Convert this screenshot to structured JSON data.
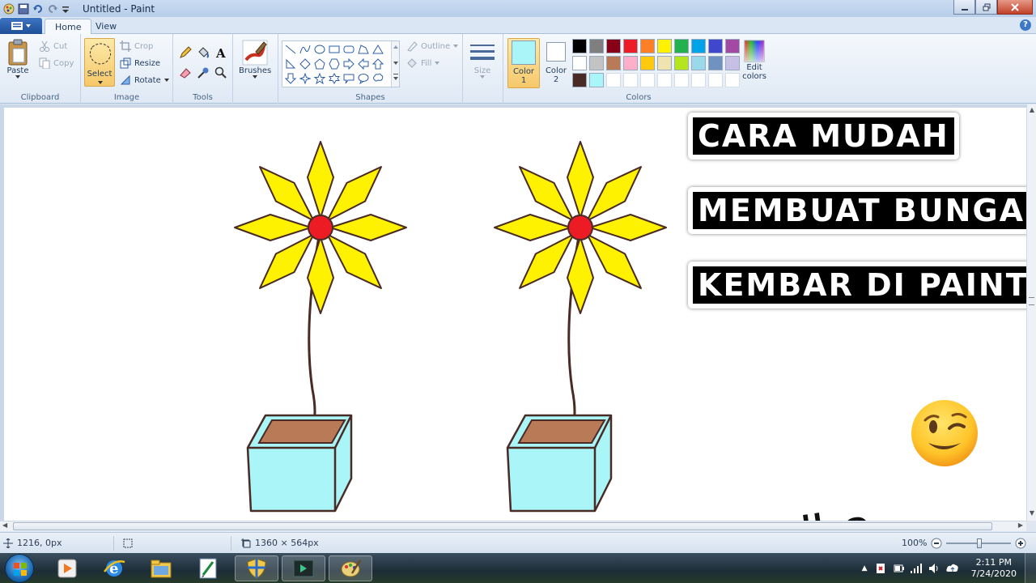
{
  "window": {
    "title": "Untitled - Paint"
  },
  "tabs": [
    {
      "label": "Home",
      "active": true
    },
    {
      "label": "View",
      "active": false
    }
  ],
  "ribbon": {
    "clipboard": {
      "group_label": "Clipboard",
      "paste": "Paste",
      "cut": "Cut",
      "copy": "Copy"
    },
    "image": {
      "group_label": "Image",
      "select": "Select",
      "crop": "Crop",
      "resize": "Resize",
      "rotate": "Rotate"
    },
    "tools": {
      "group_label": "Tools"
    },
    "brushes": {
      "label": "Brushes"
    },
    "shapes": {
      "group_label": "Shapes",
      "outline": "Outline",
      "fill": "Fill"
    },
    "size": {
      "label": "Size"
    },
    "colors": {
      "group_label": "Colors",
      "color1_label": "Color",
      "color1_num": "1",
      "color2_label": "Color",
      "color2_num": "2",
      "edit_colors": "Edit",
      "edit_colors_2": "colors",
      "color1": "#a9f5f7",
      "color2": "#ffffff",
      "palette_row1": [
        "#000000",
        "#7f7f7f",
        "#880015",
        "#ed1c24",
        "#ff7f27",
        "#fff200",
        "#22b14c",
        "#00a2e8",
        "#3f48cc",
        "#a349a4"
      ],
      "palette_row2": [
        "#ffffff",
        "#c3c3c3",
        "#b97a57",
        "#ffaec9",
        "#ffc90e",
        "#efe4b0",
        "#b5e61d",
        "#99d9ea",
        "#7092be",
        "#c8bfe7"
      ],
      "palette_row3": [
        "#4a2a25",
        "#a9f5f7",
        "#ffffff",
        "#ffffff",
        "#ffffff",
        "#ffffff",
        "#ffffff",
        "#ffffff",
        "#ffffff",
        "#ffffff"
      ]
    }
  },
  "canvas": {
    "title_line1": "CARA MUDAH",
    "title_line2": "MEMBUAT BUNGA",
    "title_line3": "KEMBAR DI PAINT",
    "caption": "Simple lho",
    "emoji": "😉",
    "petal_color": "#fff200",
    "center_color": "#ed1c24",
    "pot_color": "#a9f5f7",
    "soil_color": "#b97a57",
    "outline_color": "#4a2a25"
  },
  "statusbar": {
    "cursor_pos": "1216, 0px",
    "canvas_size": "1360 × 564px",
    "zoom": "100%"
  },
  "taskbar": {
    "time": "2:11 PM",
    "date": "7/24/2020"
  }
}
